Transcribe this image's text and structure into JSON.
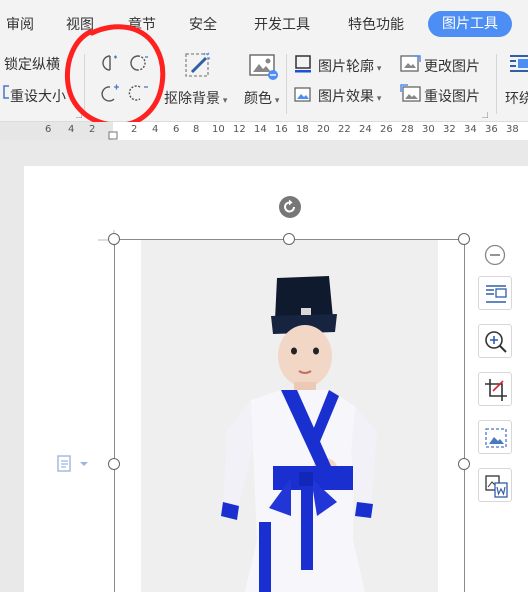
{
  "tabs": [
    "审阅",
    "视图",
    "章节",
    "安全",
    "开发工具",
    "特色功能"
  ],
  "active_tab": "图片工具",
  "ribbon": {
    "lock_ratio": "锁定纵横",
    "reset_size": "重设大小",
    "remove_bg": "抠除背景",
    "color": "颜色",
    "outline": "图片轮廓",
    "effects": "图片效果",
    "change_pic": "更改图片",
    "reset_pic": "重设图片",
    "wrap": "环绕"
  },
  "ruler_numbers": [
    "6",
    "4",
    "2",
    "2",
    "4",
    "6",
    "8",
    "10",
    "12",
    "14",
    "16",
    "18",
    "20",
    "22",
    "24",
    "26",
    "28",
    "30",
    "32",
    "34",
    "36",
    "38"
  ],
  "colors": {
    "accent": "#4d8ef4",
    "annotation": "#ff2020",
    "robe": "#1a2fd0"
  }
}
